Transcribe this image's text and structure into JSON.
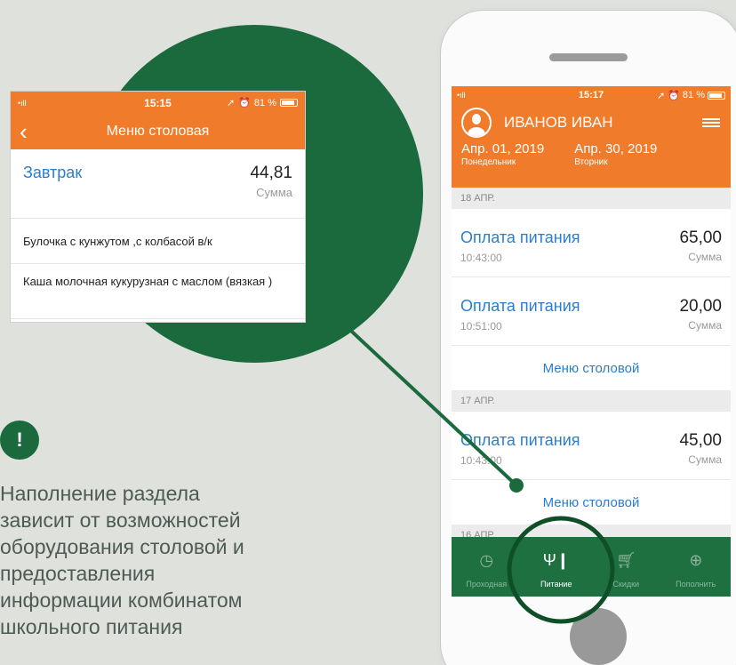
{
  "popup": {
    "signal": "•ıll",
    "time": "15:15",
    "battery_text": "81 %",
    "title": "Меню столовая",
    "meal_name": "Завтрак",
    "amount": "44,81",
    "sum_label": "Сумма",
    "items": [
      "Булочка с кунжутом ,с колбасой в/к",
      "Каша молочная кукурузная с маслом (вязкая )"
    ]
  },
  "note": {
    "badge": "!",
    "text": "Наполнение раздела зависит от возможностей оборудования столовой и предоставления информации комбинатом школьного питания"
  },
  "phone": {
    "status": {
      "signal": "•ıll",
      "time": "15:17",
      "battery_text": "81 %"
    },
    "user_name": "ИВАНОВ ИВАН",
    "dates": [
      {
        "date": "Апр. 01, 2019",
        "weekday": "Понедельник"
      },
      {
        "date": "Апр. 30, 2019",
        "weekday": "Вторник"
      }
    ],
    "sections": [
      {
        "label": "18 АПР.",
        "transactions": [
          {
            "title": "Оплата питания",
            "time": "10:43:00",
            "amount": "65,00",
            "sum_label": "Сумма"
          },
          {
            "title": "Оплата питания",
            "time": "10:51:00",
            "amount": "20,00",
            "sum_label": "Сумма"
          }
        ],
        "menu_link": "Меню столовой"
      },
      {
        "label": "17 АПР.",
        "transactions": [
          {
            "title": "Оплата питания",
            "time": "10:43:00",
            "amount": "45,00",
            "sum_label": "Сумма"
          }
        ],
        "menu_link": "Меню столовой"
      },
      {
        "label": "16 АПР."
      }
    ],
    "tabs": [
      {
        "label": "Проходная",
        "icon": "clock-icon"
      },
      {
        "label": "Питание",
        "icon": "fork-knife-icon"
      },
      {
        "label": "Скидки",
        "icon": "cart-icon"
      },
      {
        "label": "Пополнить",
        "icon": "location-plus-icon"
      }
    ]
  },
  "colors": {
    "accent_orange": "#f07b2a",
    "brand_green": "#1b6a3d",
    "link_blue": "#2a7ecb",
    "background": "#dfe2dc"
  }
}
